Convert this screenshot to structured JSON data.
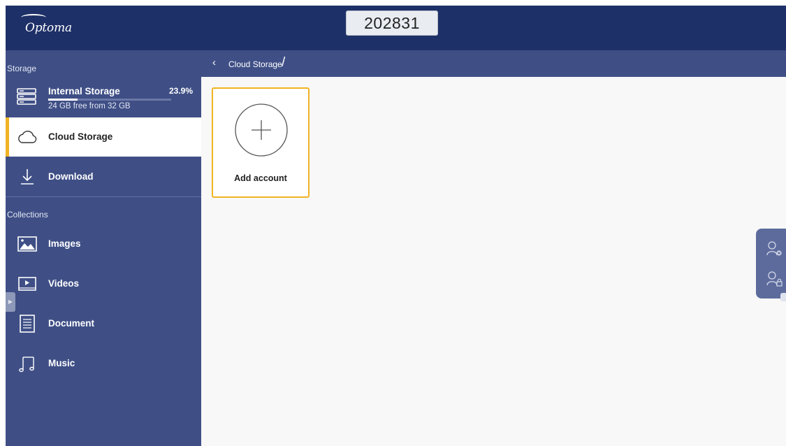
{
  "header": {
    "brand": "Optoma",
    "session_code": "202831"
  },
  "sidebar": {
    "storage_label": "Storage",
    "internal_storage": {
      "title": "Internal Storage",
      "percent": "23.9%",
      "used_fraction": 0.239,
      "subtitle": "24 GB free from 32 GB"
    },
    "storage_items": [
      {
        "label": "Cloud Storage",
        "icon": "cloud-icon",
        "active": true
      },
      {
        "label": "Download",
        "icon": "download-icon",
        "active": false
      }
    ],
    "collections_label": "Collections",
    "collection_items": [
      {
        "label": "Images",
        "icon": "image-icon"
      },
      {
        "label": "Videos",
        "icon": "video-icon"
      },
      {
        "label": "Document",
        "icon": "document-icon"
      },
      {
        "label": "Music",
        "icon": "music-icon"
      }
    ]
  },
  "breadcrumb": {
    "path": "Cloud Storage",
    "separator": "/"
  },
  "main": {
    "add_account_label": "Add account"
  },
  "colors": {
    "header_bg": "#1e3068",
    "sidebar_bg": "#3f4f86",
    "accent": "#f0b323",
    "content_bg": "#f8f8f8"
  }
}
